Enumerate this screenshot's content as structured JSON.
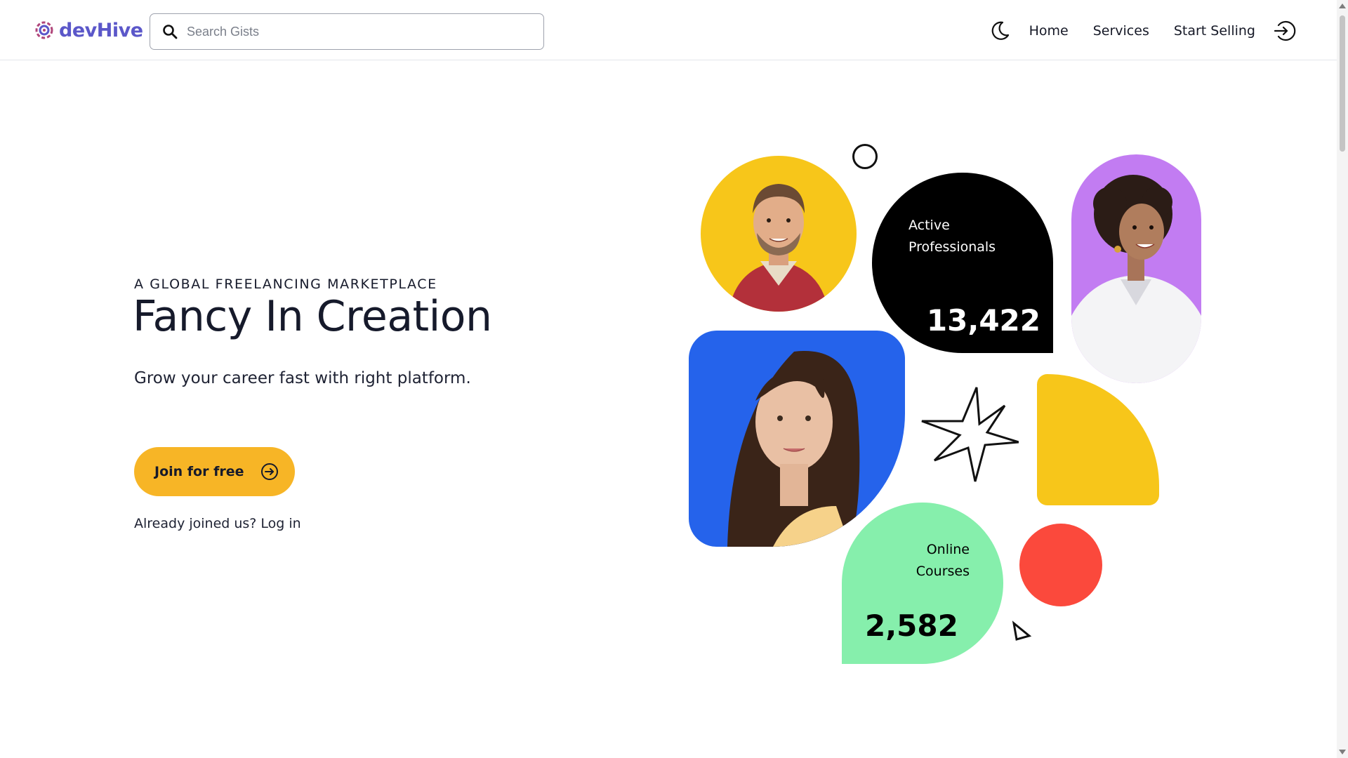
{
  "header": {
    "logo_text": "devHive",
    "search": {
      "placeholder": "Search Gists",
      "icon": "search-icon"
    },
    "nav": {
      "theme_icon": "moon-icon",
      "items": [
        {
          "label": "Home"
        },
        {
          "label": "Services"
        },
        {
          "label": "Start Selling"
        }
      ],
      "login_icon": "login-icon"
    }
  },
  "hero": {
    "eyebrow": "A GLOBAL FREELANCING MARKETPLACE",
    "title": "Fancy In Creation",
    "subtitle": "Grow your career fast with right platform.",
    "cta_label": "Join for free",
    "login_text": "Already joined us? Log in"
  },
  "stats": {
    "professionals": {
      "label_line1": "Active",
      "label_line2": "Professionals",
      "value": "13,422"
    },
    "courses": {
      "label_line1": "Online",
      "label_line2": "Courses",
      "value": "2,582"
    }
  },
  "colors": {
    "brand": "#5b57c9",
    "cta": "#f7b526",
    "yellow": "#f7c61a",
    "blue": "#2563eb",
    "purple": "#c27cf2",
    "green": "#86efac",
    "red": "#fb493c"
  }
}
